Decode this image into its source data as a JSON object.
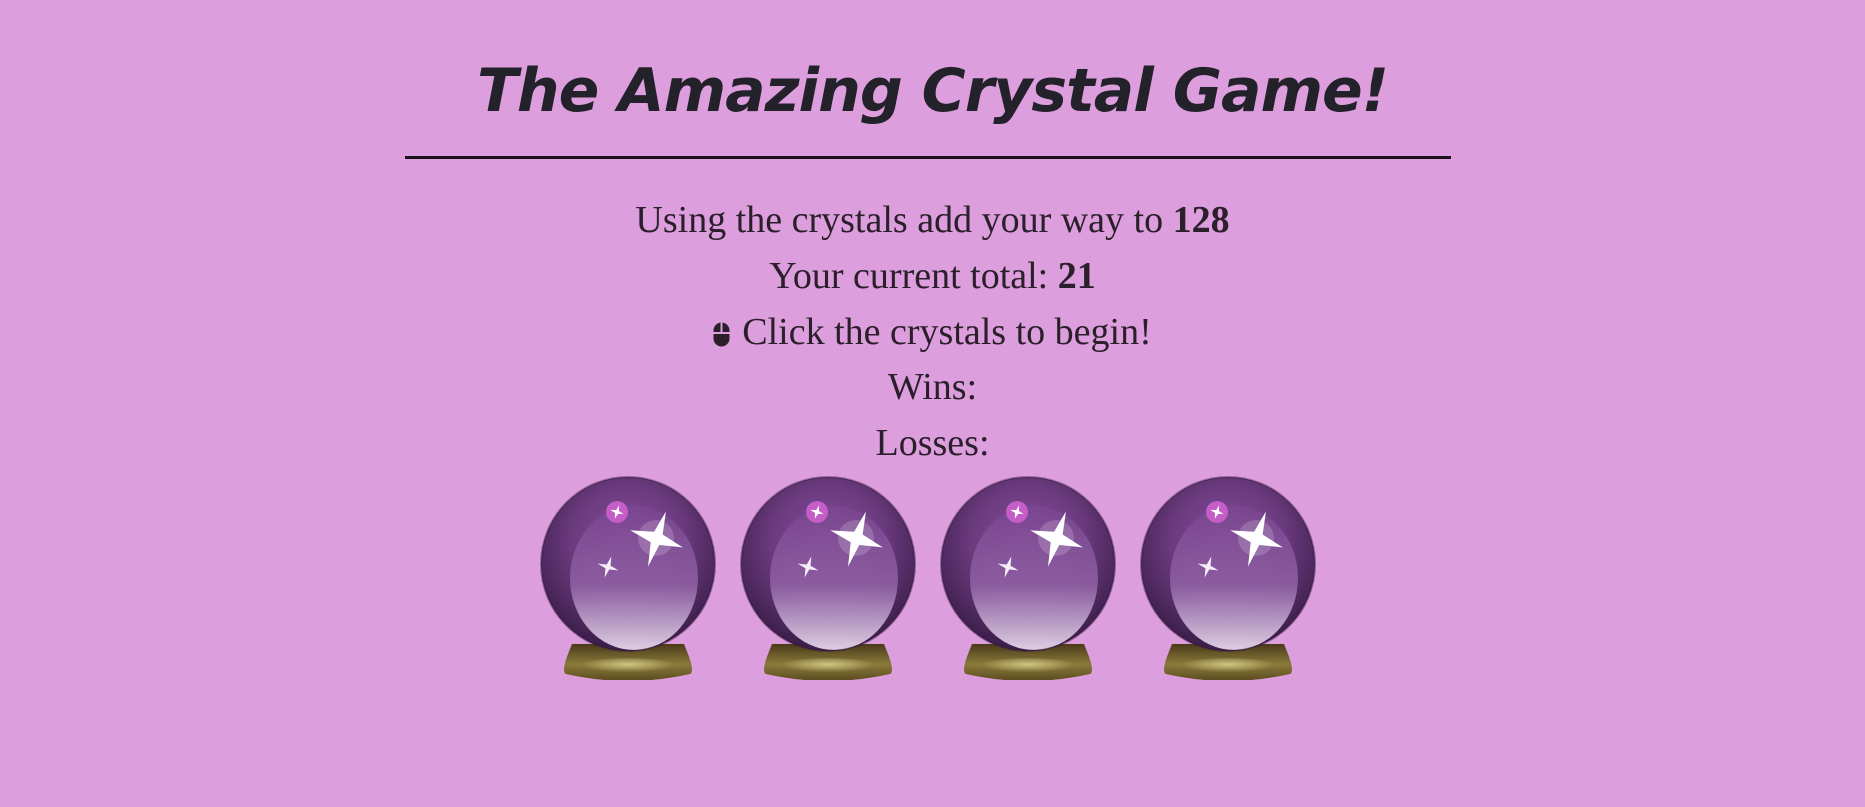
{
  "game": {
    "title": "The Amazing Crystal Game!",
    "target_prefix": "Using the crystals add your way to",
    "target_value": "128",
    "total_prefix": "Your current total:",
    "total_value": "21",
    "instruction": "Click the crystals to begin!",
    "wins_label": "Wins:",
    "losses_label": "Losses:"
  },
  "crystals": [
    {
      "icon": "crystal-ball-icon"
    },
    {
      "icon": "crystal-ball-icon"
    },
    {
      "icon": "crystal-ball-icon"
    },
    {
      "icon": "crystal-ball-icon"
    }
  ],
  "colors": {
    "background": "#dc9edc",
    "text": "#2a1f2a",
    "crystal_purple": "#6a3a7e",
    "base_gold": "#8a7a3a"
  }
}
